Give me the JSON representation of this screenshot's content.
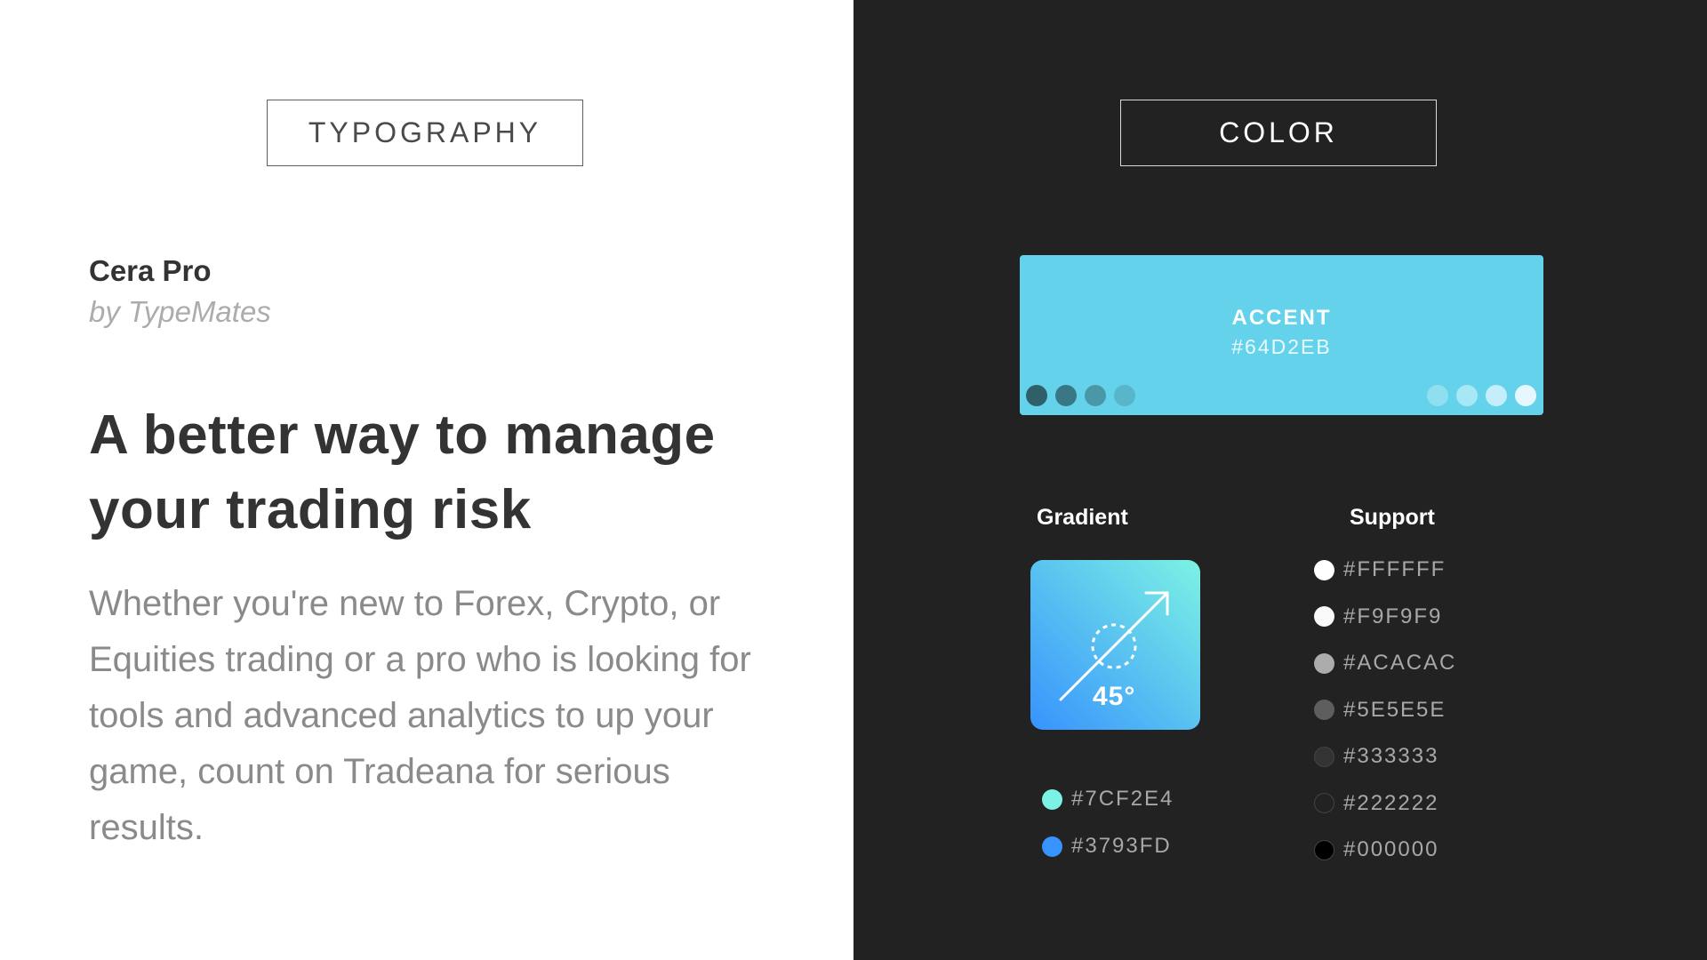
{
  "typography": {
    "section_label": "TYPOGRAPHY",
    "font_name": "Cera Pro",
    "font_author": "by TypeMates",
    "headline": "A better way to manage your trading risk",
    "body": "Whether you're new to Forex, Crypto, or Equities trading or a pro who is looking for tools and advanced analytics to up your game, count on Tradeana for serious results."
  },
  "color": {
    "section_label": "COLOR",
    "accent": {
      "label": "ACCENT",
      "hex": "#64D2EB",
      "color": "#64D2EB",
      "dark_shades": [
        "#2f5f69",
        "#3a7785",
        "#4a97a8",
        "#58b5ca"
      ],
      "light_tints": [
        "#8fdff1",
        "#a8e7f5",
        "#c4effa",
        "#e6f8fd"
      ]
    },
    "gradient": {
      "title": "Gradient",
      "angle_label": "45°",
      "icon": "arrow-angle-icon",
      "stops": [
        {
          "hex": "#7CF2E4",
          "color": "#7CF2E4"
        },
        {
          "hex": "#3793FD",
          "color": "#3793FD"
        }
      ]
    },
    "support": {
      "title": "Support",
      "swatches": [
        {
          "hex": "#FFFFFF",
          "color": "#FFFFFF"
        },
        {
          "hex": "#F9F9F9",
          "color": "#F9F9F9"
        },
        {
          "hex": "#ACACAC",
          "color": "#ACACAC"
        },
        {
          "hex": "#5E5E5E",
          "color": "#5E5E5E"
        },
        {
          "hex": "#333333",
          "color": "#333333"
        },
        {
          "hex": "#222222",
          "color": "#222222"
        },
        {
          "hex": "#000000",
          "color": "#000000"
        }
      ]
    }
  }
}
